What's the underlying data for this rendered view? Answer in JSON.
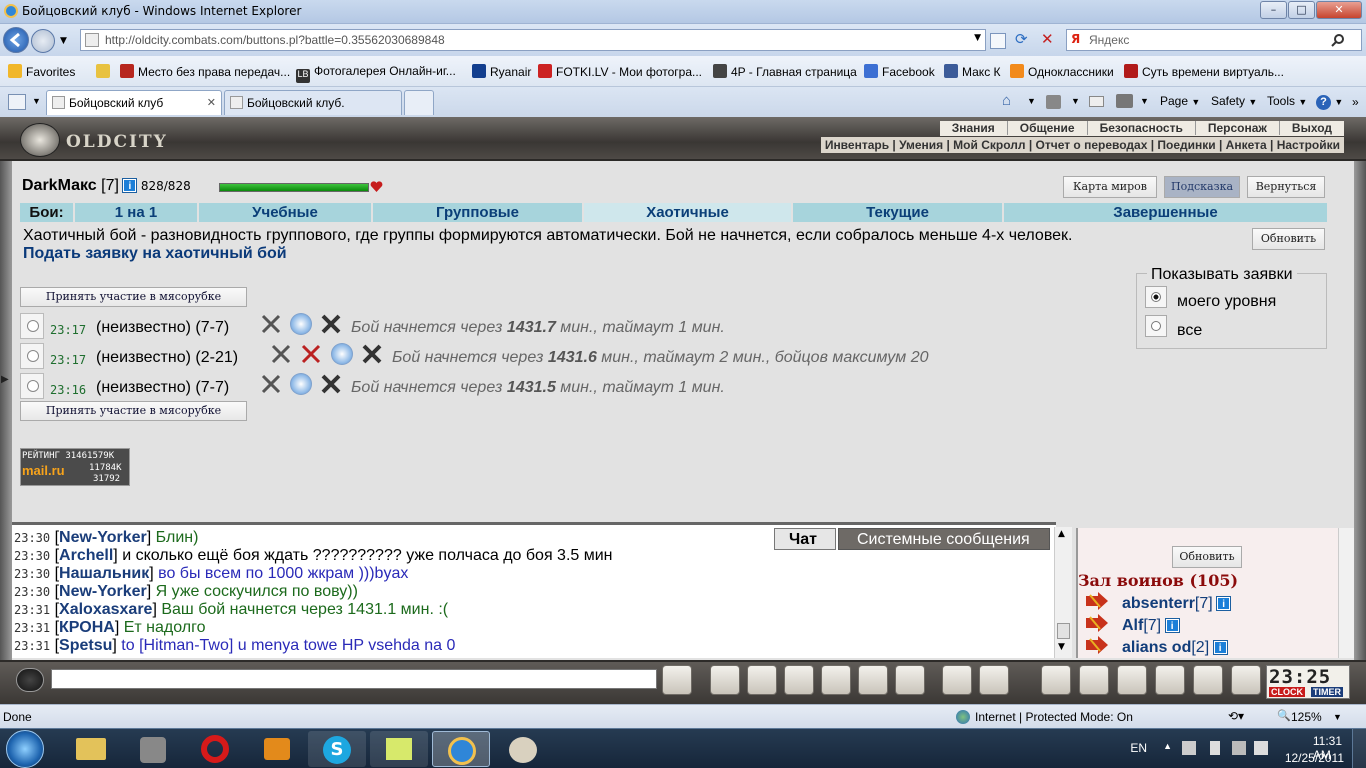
{
  "window": {
    "title": "Бойцовский клуб - Windows Internet Explorer",
    "min": "–",
    "max": "□",
    "close": "✕"
  },
  "address": {
    "url": "http://oldcity.combats.com/buttons.pl?battle=0.35562030689848",
    "search_placeholder": "Яндекс"
  },
  "favorites": {
    "label": "Favorites",
    "items": [
      "Место без права передач...",
      "Фотогалерея Онлайн-иг...",
      "Ryanair",
      "FOTKI.LV - Мои фотогра...",
      "4P - Главная страница",
      "Facebook",
      "Макс К",
      "Одноклассники",
      "Суть времени  виртуаль..."
    ]
  },
  "tabs": [
    {
      "label": "Бойцовский клуб"
    },
    {
      "label": "Бойцовский клуб."
    }
  ],
  "tab_close": "✕",
  "toolbar": {
    "page": "Page",
    "safety": "Safety",
    "tools": "Tools",
    "help": "?"
  },
  "game": {
    "logo": "OLDCITY",
    "menu_top": [
      "Знания",
      "Общение",
      "Безопасность",
      "Персонаж",
      "Выход"
    ],
    "menu_bottom": "Инвентарь | Умения | Мой Скролл | Отчет о переводах | Поединки | Анкета | Настройки",
    "user": {
      "name": "DarkМакс",
      "level": "[7]",
      "hp": "828/828",
      "info": "i"
    },
    "top_buttons": {
      "map": "Карта миров",
      "hint": "Подсказка",
      "back": "Вернуться"
    },
    "battle_tabs": {
      "label": "Бои:",
      "items": [
        "1 на 1",
        "Учебные",
        "Групповые",
        "Хаотичные",
        "Текущие",
        "Завершенные"
      ]
    },
    "description": "Хаотичный бой - разновидность группового, где группы формируются автоматически. Бой не начнется, если собралось меньше 4-х человек.",
    "apply_link": "Подать заявку на хаотичный бой",
    "refresh": "Обновить",
    "join_button": "Принять участие в мясорубке",
    "rows": [
      {
        "time": "23:17",
        "text": "(неизвестно) (7-7)",
        "info_pre": "Бой начнется через ",
        "minutes": "1431.7",
        "info_post": " мин., таймаут 1 мин."
      },
      {
        "time": "23:17",
        "text": "(неизвестно) (2-21)",
        "info_pre": "Бой начнется через ",
        "minutes": "1431.6",
        "info_post": " мин., таймаут 2 мин., бойцов максимум 20"
      },
      {
        "time": "23:16",
        "text": "(неизвестно) (7-7)",
        "info_pre": "Бой начнется через ",
        "minutes": "1431.5",
        "info_post": " мин., таймаут 1 мин."
      }
    ],
    "show": {
      "legend": "Показывать заявки",
      "opt1": "моего уровня",
      "opt2": "все"
    },
    "counter": {
      "l1": "РЕЙТИНГ 31461579K",
      "l2": "mail.ru",
      "l3": "11784K",
      "l4": "31792"
    }
  },
  "chat": {
    "tab_chat": "Чат",
    "tab_system": "Системные сообщения",
    "messages": [
      {
        "time": "23:30",
        "nick": "New-Yorker",
        "text": "Блин)",
        "color": "#1c6a1c"
      },
      {
        "time": "23:30",
        "nick": "Archell",
        "text": "и сколько ещё боя ждать ?????????? уже полчаса до боя 3.5 мин",
        "color": "#000000"
      },
      {
        "time": "23:30",
        "nick": "Нашальник",
        "text": "во бы всем по 1000 жкрам )))byax",
        "color": "#2a2ab8"
      },
      {
        "time": "23:30",
        "nick": "New-Yorker",
        "text": "Я уже соскучился по вову))",
        "color": "#1c6a1c"
      },
      {
        "time": "23:31",
        "nick": "Xaloxasxare",
        "text": "Ваш бой начнется через 1431.1 мин. :(",
        "color": "#1c6a1c"
      },
      {
        "time": "23:31",
        "nick": "КРОНА",
        "text": "Ет надолго",
        "color": "#1c6a1c"
      },
      {
        "time": "23:31",
        "nick": "Spetsu",
        "text": "to [Hitman-Two] u menya towe HP vsehda na 0",
        "color": "#2a2ab8"
      }
    ]
  },
  "users": {
    "refresh": "Обновить",
    "header": "Зал воинов (105)",
    "list": [
      {
        "name": "absenterr",
        "level": "[7]"
      },
      {
        "name": "Alf",
        "level": "[7]"
      },
      {
        "name": "alians od",
        "level": "[2]"
      }
    ]
  },
  "clock": {
    "time": "23:25",
    "clock_label": "CLOCK",
    "timer_label": "TIMER"
  },
  "status": {
    "left": "Done",
    "zone": "Internet | Protected Mode: On",
    "zoom": "125%"
  },
  "tray": {
    "lang": "EN",
    "time": "11:31 AM",
    "date": "12/25/2011"
  }
}
